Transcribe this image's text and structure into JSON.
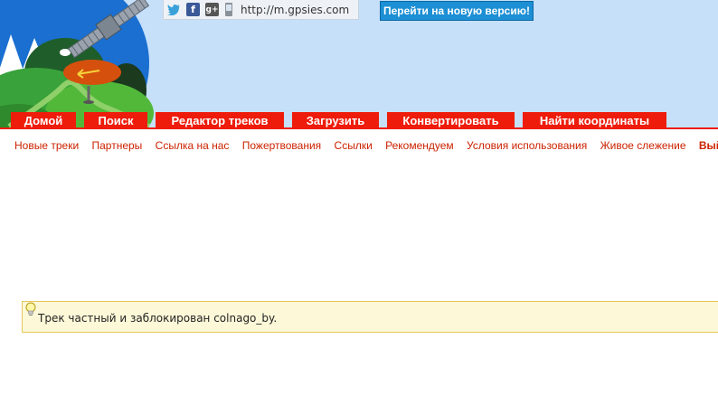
{
  "header": {
    "mobile_link": "http://m.gpsies.com",
    "new_version_button": "Перейти на новую версию!",
    "social": {
      "twitter_icon": "twitter-bird",
      "facebook_icon": "facebook-f",
      "facebook_glyph": "f",
      "gplus_icon": "google-plus",
      "gplus_glyph": "g+",
      "phone_icon": "mobile-phone"
    }
  },
  "main_nav": {
    "tabs": [
      {
        "label": "Домой"
      },
      {
        "label": "Поиск"
      },
      {
        "label": "Редактор треков"
      },
      {
        "label": "Загрузить"
      },
      {
        "label": "Конвертировать"
      },
      {
        "label": "Найти координаты"
      }
    ]
  },
  "sub_nav": {
    "items": [
      {
        "label": "Новые треки"
      },
      {
        "label": "Партнеры"
      },
      {
        "label": "Ссылка на нас"
      },
      {
        "label": "Пожертвования"
      },
      {
        "label": "Ссылки"
      },
      {
        "label": "Рекомендуем"
      },
      {
        "label": "Условия использования"
      },
      {
        "label": "Живое слежение"
      }
    ],
    "logout": "Выйти"
  },
  "notice": {
    "icon": "lightbulb",
    "text": "Трек частный и заблокирован colnago_by."
  },
  "colors": {
    "sky": "#c6e0fa",
    "nav_red": "#ee1c0b",
    "link_red": "#cc2200",
    "notice_bg": "#fcf8d8",
    "notice_border": "#e6c85a",
    "button_blue": "#1d8fd4"
  }
}
